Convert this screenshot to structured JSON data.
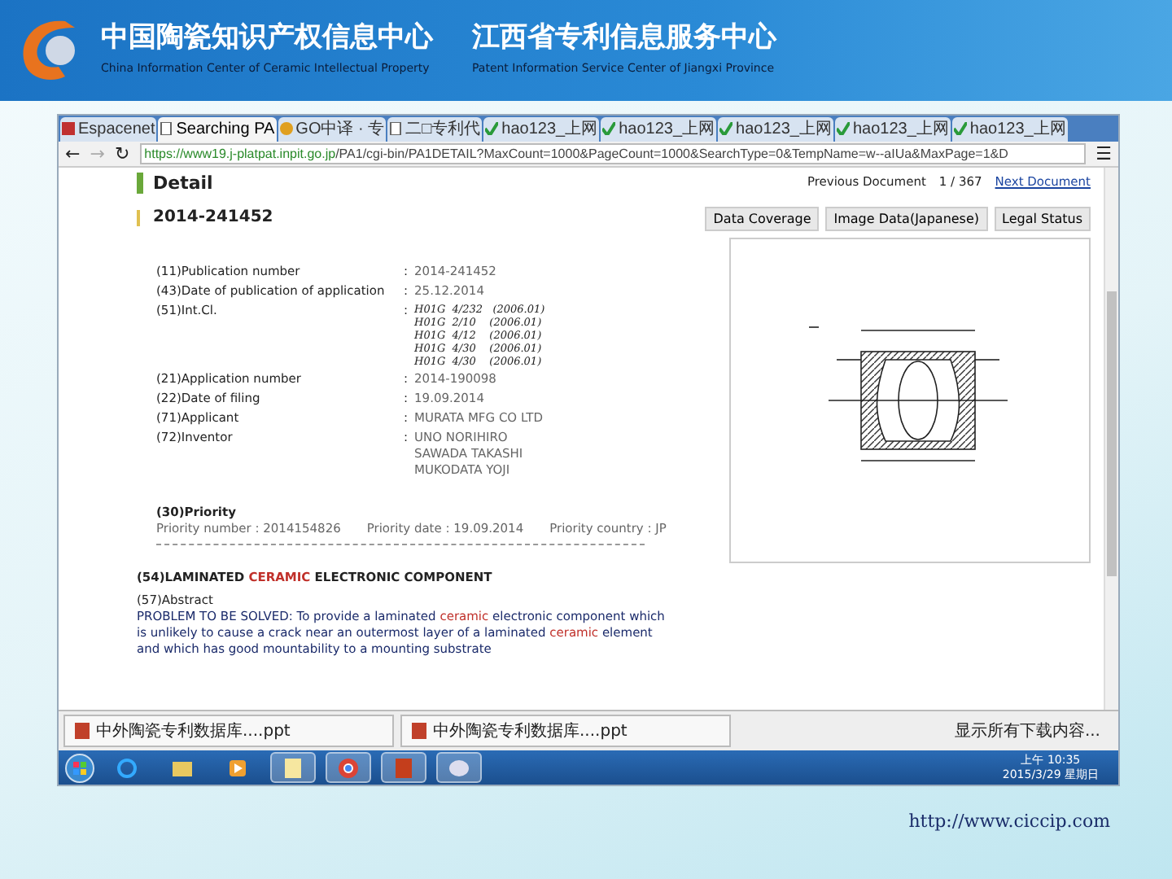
{
  "banner": {
    "title_cn_1": "中国陶瓷知识产权信息中心",
    "title_en_1": "China Information Center of Ceramic Intellectual Property",
    "title_cn_2": "江西省专利信息服务中心",
    "title_en_2": "Patent Information Service Center of Jiangxi Province"
  },
  "browser": {
    "tabs": [
      {
        "label": "Espacenet",
        "kind": "espacenet",
        "selected": false
      },
      {
        "label": "Searching PA",
        "kind": "page",
        "selected": true
      },
      {
        "label": "GO中译 · 专",
        "kind": "go",
        "selected": false
      },
      {
        "label": "二□专利代",
        "kind": "page",
        "selected": false
      },
      {
        "label": "hao123_上网",
        "kind": "hao",
        "selected": false
      },
      {
        "label": "hao123_上网",
        "kind": "hao",
        "selected": false
      },
      {
        "label": "hao123_上网",
        "kind": "hao",
        "selected": false
      },
      {
        "label": "hao123_上网",
        "kind": "hao",
        "selected": false
      },
      {
        "label": "hao123_上网",
        "kind": "hao",
        "selected": false
      }
    ],
    "nav": {
      "back": "←",
      "forward": "→",
      "reload": "↻",
      "menu": "☰"
    },
    "url_host": "https://www19.j-platpat.inpit.go.jp",
    "url_path": "/PA1/cgi-bin/PA1DETAIL?MaxCount=1000&PageCount=1000&SearchType=0&TempName=w--aIUa&MaxPage=1&D"
  },
  "detail": {
    "heading": "Detail",
    "prev": "Previous Document",
    "position": "1 / 367",
    "next": "Next Document",
    "doc_number": "2014-241452",
    "buttons": [
      "Data Coverage",
      "Image Data(Japanese)",
      "Legal Status"
    ],
    "separator": ":",
    "fields": [
      {
        "label": "(11)Publication number",
        "kind": "text",
        "values": [
          "2014-241452"
        ]
      },
      {
        "label": "(43)Date of publication of application",
        "kind": "text",
        "values": [
          "25.12.2014"
        ]
      },
      {
        "label": "(51)Int.Cl.",
        "kind": "classification",
        "values": [
          "H01G  4/232   (2006.01)",
          "H01G  2/10    (2006.01)",
          "H01G  4/12    (2006.01)",
          "H01G  4/30    (2006.01)",
          "H01G  4/30    (2006.01)"
        ]
      },
      {
        "label": "(21)Application number",
        "kind": "text",
        "values": [
          "2014-190098"
        ]
      },
      {
        "label": "(22)Date of filing",
        "kind": "text",
        "values": [
          "19.09.2014"
        ]
      },
      {
        "label": "(71)Applicant",
        "kind": "text",
        "values": [
          "MURATA MFG CO LTD"
        ]
      },
      {
        "label": "(72)Inventor",
        "kind": "text",
        "values": [
          "UNO NORIHIRO",
          "SAWADA TAKASHI",
          "MUKODATA YOJI"
        ]
      }
    ],
    "priority_heading": "(30)Priority",
    "priority": [
      "Priority number : 2014154826",
      "Priority date : 19.09.2014",
      "Priority country : JP"
    ],
    "title": [
      {
        "text": "(54)LAMINATED ",
        "highlight": false
      },
      {
        "text": "CERAMIC",
        "highlight": true
      },
      {
        "text": " ELECTRONIC COMPONENT",
        "highlight": false
      }
    ],
    "abstract_heading": "(57)Abstract",
    "abstract": [
      {
        "text": "PROBLEM TO BE SOLVED: To provide a laminated ",
        "highlight": false
      },
      {
        "text": "ceramic",
        "highlight": true
      },
      {
        "text": " electronic component which is unlikely to cause a crack near an outermost layer of a laminated ",
        "highlight": false
      },
      {
        "text": "ceramic",
        "highlight": true
      },
      {
        "text": " element and which has good mountability to a mounting substrate",
        "highlight": false
      }
    ]
  },
  "downloads": {
    "files": [
      "中外陶瓷专利数据库....ppt",
      "中外陶瓷专利数据库....ppt"
    ],
    "show_all": "显示所有下载内容..."
  },
  "taskbar": {
    "apps": [
      {
        "kind": "ie",
        "running": false
      },
      {
        "kind": "folder",
        "running": false
      },
      {
        "kind": "media",
        "running": false
      },
      {
        "kind": "note",
        "running": true
      },
      {
        "kind": "chrome",
        "running": true
      },
      {
        "kind": "ppt",
        "running": true
      },
      {
        "kind": "paint",
        "running": true
      }
    ],
    "time": "上午 10:35",
    "date": "2015/3/29 星期日"
  },
  "footer_url": "http://www.ciccip.com"
}
